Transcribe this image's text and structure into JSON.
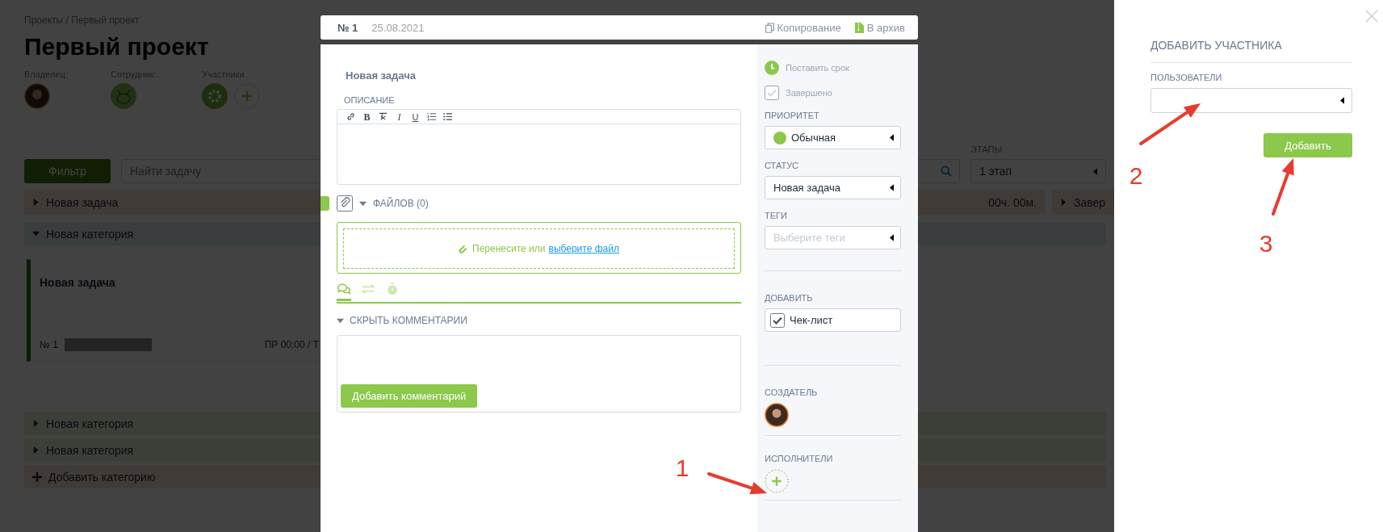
{
  "breadcrumb": "Проекты / Первый проект",
  "project_title": "Первый проект",
  "team": [
    {
      "label": "Владелец:",
      "avatars": [
        {
          "kind": "person"
        }
      ]
    },
    {
      "label": "Сотрудник:",
      "avatars": [
        {
          "kind": "mascot"
        }
      ]
    },
    {
      "label": "Участники",
      "avatars": [
        {
          "kind": "gear"
        },
        {
          "kind": "add"
        }
      ]
    }
  ],
  "filter_button": "Фильтр",
  "search": {
    "placeholder": "Найти задачу"
  },
  "stages": {
    "label": "ЭТАПЫ",
    "value": "1 этап"
  },
  "task_row": {
    "title": "Новая задача",
    "time": "00ч. 00м.",
    "expanded": false,
    "next_label": "Завер"
  },
  "categories": [
    {
      "title": "Новая категория",
      "expanded": true,
      "tasks": [
        {
          "title": "Новая задача",
          "number": "№ 1",
          "schedule": "ПР 00:00 / Т"
        }
      ]
    },
    {
      "title": "Новая категория",
      "expanded": false
    },
    {
      "title": "Новая категория",
      "expanded": false
    }
  ],
  "add_category": "Добавить категорию",
  "modal": {
    "number": "№ 1",
    "date": "25.08.2021",
    "actions": [
      {
        "kind": "copy",
        "label": "Копирование"
      },
      {
        "kind": "archive",
        "label": "В архив"
      }
    ],
    "title": "Новая задача",
    "description_label": "ОПИСАНИЕ",
    "toolbar": [
      {
        "kind": "link"
      },
      {
        "kind": "bold",
        "label": "B"
      },
      {
        "kind": "clear"
      },
      {
        "kind": "italic",
        "label": "I"
      },
      {
        "kind": "underline",
        "label": "U"
      },
      {
        "kind": "ordered-list"
      },
      {
        "kind": "bullet-list"
      }
    ],
    "files": {
      "label": "ФАЙЛОВ (0)",
      "expanded": true
    },
    "dropzone": {
      "text": "Перенесите или",
      "link": "выберите файл"
    },
    "tabs": [
      {
        "kind": "comments",
        "selected": true
      },
      {
        "kind": "history",
        "selected": false
      },
      {
        "kind": "timer",
        "selected": false
      }
    ],
    "comments_toggle": {
      "label": "СКРЫТЬ КОММЕНТАРИИ",
      "expanded": true
    },
    "comment_button": "Добавить комментарий",
    "sidebar": {
      "deadline": "Поставить срок",
      "done": {
        "label": "Завершено",
        "checked": false
      },
      "priority": {
        "label": "ПРИОРИТЕТ",
        "value": "Обычная"
      },
      "status": {
        "label": "СТАТУС",
        "value": "Новая задача"
      },
      "tags": {
        "label": "ТЕГИ",
        "placeholder": "Выберите теги"
      },
      "add": {
        "label": "ДОБАВИТЬ",
        "items": [
          {
            "label": "Чек-лист"
          }
        ]
      },
      "creator": {
        "label": "СОЗДАТЕЛЬ"
      },
      "assignees": {
        "label": "ИСПОЛНИТЕЛИ"
      }
    }
  },
  "panel": {
    "title": "ДОБАВИТЬ УЧАСТНИКА",
    "users_label": "ПОЛЬЗОВАТЕЛИ",
    "add_button": "Добавить"
  },
  "annotations": [
    {
      "label": "1"
    },
    {
      "label": "2"
    },
    {
      "label": "3"
    }
  ]
}
